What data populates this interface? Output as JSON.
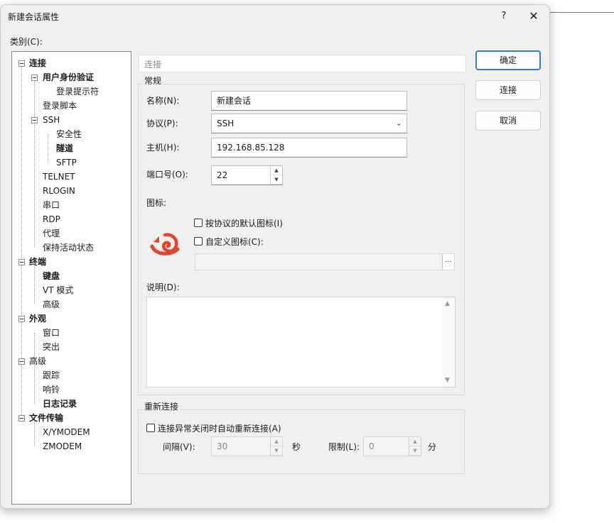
{
  "dialog": {
    "title": "新建会话属性",
    "help": "?",
    "close": "✕",
    "category_label": "类别(C):"
  },
  "tree": [
    {
      "label": "连接",
      "bold": true
    },
    {
      "label": "用户身份验证",
      "bold": true
    },
    {
      "label": "登录提示符",
      "bold": false
    },
    {
      "label": "登录脚本",
      "bold": false
    },
    {
      "label": "SSH",
      "bold": false
    },
    {
      "label": "安全性",
      "bold": false
    },
    {
      "label": "隧道",
      "bold": true
    },
    {
      "label": "SFTP",
      "bold": false
    },
    {
      "label": "TELNET",
      "bold": false
    },
    {
      "label": "RLOGIN",
      "bold": false
    },
    {
      "label": "串口",
      "bold": false
    },
    {
      "label": "RDP",
      "bold": false
    },
    {
      "label": "代理",
      "bold": false
    },
    {
      "label": "保持活动状态",
      "bold": false
    },
    {
      "label": "终端",
      "bold": true
    },
    {
      "label": "键盘",
      "bold": true
    },
    {
      "label": "VT 模式",
      "bold": false
    },
    {
      "label": "高级",
      "bold": false
    },
    {
      "label": "外观",
      "bold": true
    },
    {
      "label": "窗口",
      "bold": false
    },
    {
      "label": "突出",
      "bold": false
    },
    {
      "label": "高级",
      "bold": false
    },
    {
      "label": "跟踪",
      "bold": false
    },
    {
      "label": "响铃",
      "bold": false
    },
    {
      "label": "日志记录",
      "bold": true
    },
    {
      "label": "文件传输",
      "bold": true
    },
    {
      "label": "X/YMODEM",
      "bold": false
    },
    {
      "label": "ZMODEM",
      "bold": false
    }
  ],
  "panel": {
    "header": "连接",
    "general_group": "常规",
    "name_label": "名称(N):",
    "name_value": "新建会话",
    "protocol_label": "协议(P):",
    "protocol_value": "SSH",
    "host_label": "主机(H):",
    "host_value": "192.168.85.128",
    "port_label": "端口号(O):",
    "port_value": "22",
    "icon_label": "图标:",
    "default_icon_label": "按协议的默认图标(I)",
    "custom_icon_label": "自定义图标(C):",
    "browse_label": "...",
    "description_label": "说明(D):",
    "reconnect_group": "重新连接",
    "auto_reconnect_label": "连接异常关闭时自动重新连接(A)",
    "interval_label": "间隔(V):",
    "interval_value": "30",
    "seconds_unit": "秒",
    "limit_label": "限制(L):",
    "limit_value": "0",
    "minutes_unit": "分"
  },
  "buttons": {
    "ok": "确定",
    "connect": "连接",
    "cancel": "取消"
  },
  "colors": {
    "accent": "#3a76c7",
    "logo": "#e4432d"
  }
}
